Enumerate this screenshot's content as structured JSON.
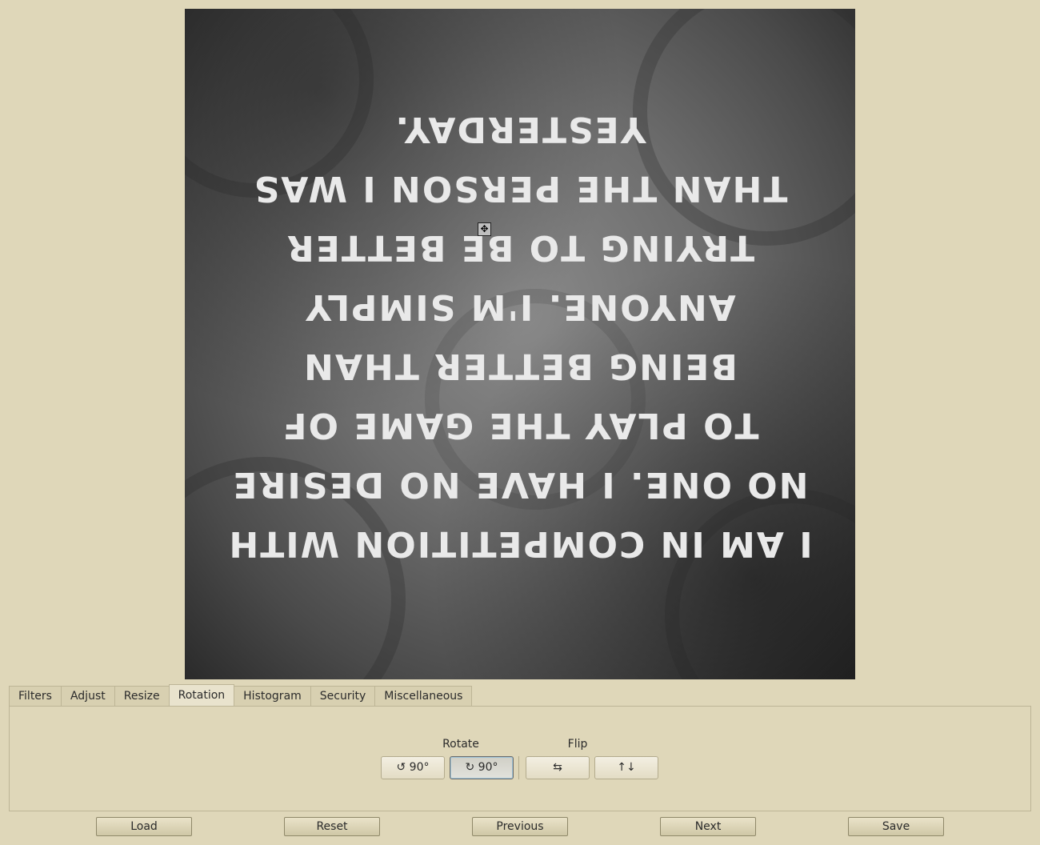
{
  "image": {
    "quote_lines": [
      "I AM IN COMPETITION WITH",
      "NO ONE.  I HAVE NO DESIRE",
      "TO PLAY THE GAME OF",
      "BEING BETTER THAN",
      "ANYONE.  I'M SIMPLY",
      "TRYING TO BE BETTER",
      "THAN THE PERSON I WAS",
      "YESTERDAY."
    ],
    "orientation": "rotated 180 degrees (upside down)"
  },
  "tabs": [
    {
      "label": "Filters",
      "active": false
    },
    {
      "label": "Adjust",
      "active": false
    },
    {
      "label": "Resize",
      "active": false
    },
    {
      "label": "Rotation",
      "active": true
    },
    {
      "label": "Histogram",
      "active": false
    },
    {
      "label": "Security",
      "active": false
    },
    {
      "label": "Miscellaneous",
      "active": false
    }
  ],
  "rotation_panel": {
    "rotate_label": "Rotate",
    "flip_label": "Flip",
    "rotate_ccw_label": "↺ 90°",
    "rotate_cw_label": "↻ 90°",
    "flip_horizontal_label": "⇆",
    "flip_vertical_label": "↑↓"
  },
  "bottom_buttons": {
    "load": "Load",
    "reset": "Reset",
    "previous": "Previous",
    "next": "Next",
    "save": "Save"
  },
  "colors": {
    "window_background": "#dfd7b9",
    "quote_text": "#e9e9e9"
  }
}
